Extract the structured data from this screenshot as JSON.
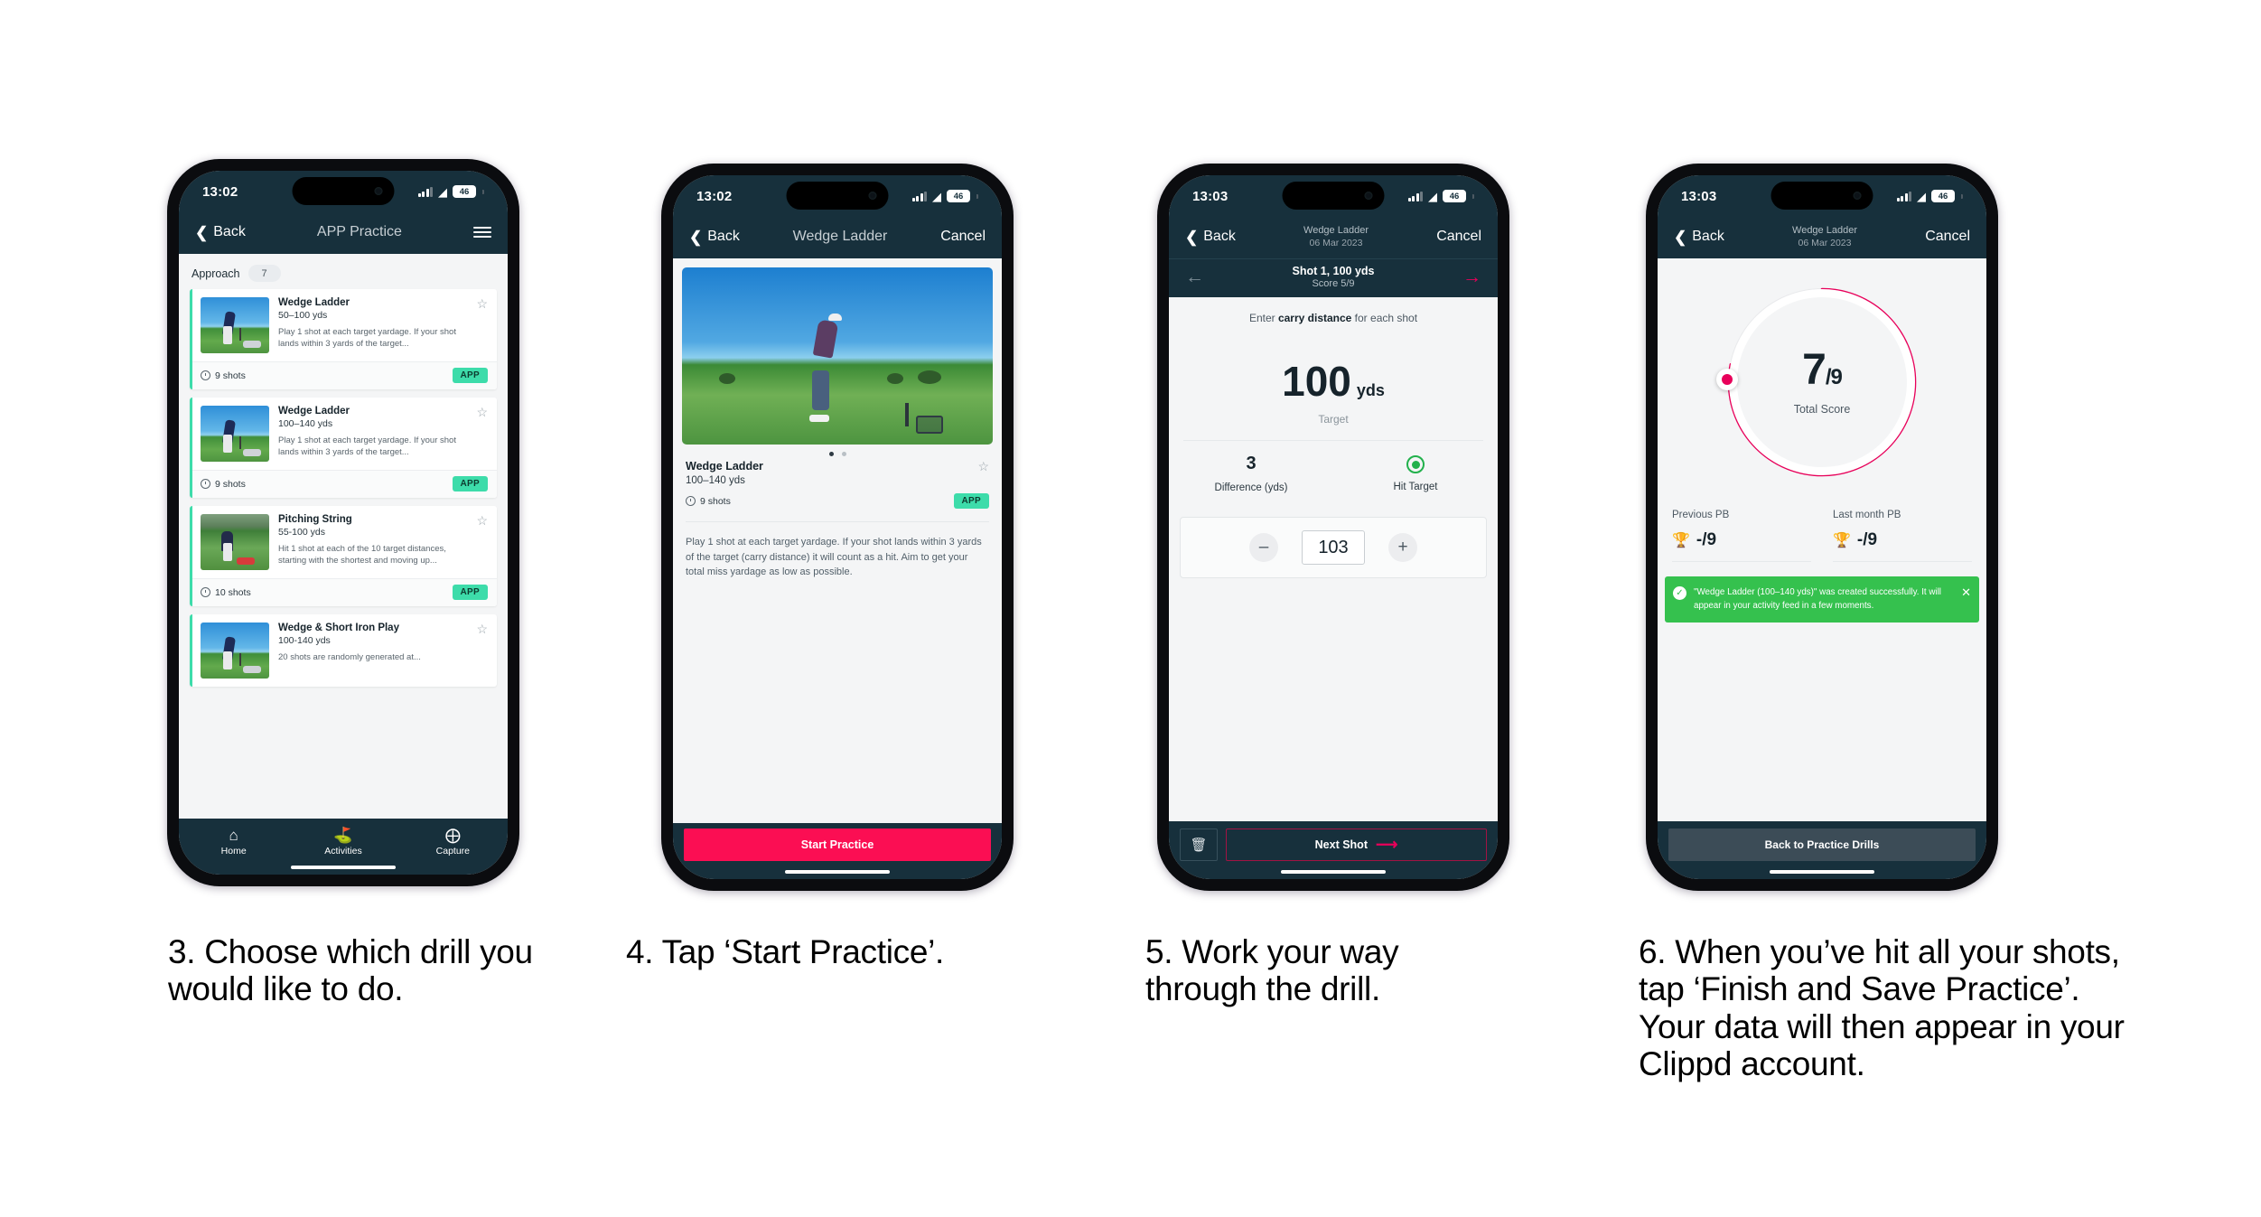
{
  "theme": {
    "navy": "#17303c",
    "pink": "#fb0e53",
    "teal": "#3ddcaa",
    "green": "#35c14e",
    "page_bg": "#ffffff"
  },
  "phones": [
    {
      "id": "phone-1",
      "status": {
        "time": "13:02",
        "battery": "46"
      },
      "nav": {
        "back": "Back",
        "title": "APP Practice",
        "menu_icon": "hamburger-icon"
      },
      "section": {
        "label": "Approach",
        "count": "7"
      },
      "cards": [
        {
          "title": "Wedge Ladder",
          "range": "50–100 yds",
          "desc": "Play 1 shot at each target yardage. If your shot lands within 3 yards of the target...",
          "shots": "9 shots",
          "tag": "APP"
        },
        {
          "title": "Wedge Ladder",
          "range": "100–140 yds",
          "desc": "Play 1 shot at each target yardage. If your shot lands within 3 yards of the target...",
          "shots": "9 shots",
          "tag": "APP"
        },
        {
          "title": "Pitching String",
          "range": "55-100 yds",
          "desc": "Hit 1 shot at each of the 10 target distances, starting with the shortest and moving up...",
          "shots": "10 shots",
          "tag": "APP"
        },
        {
          "title": "Wedge & Short Iron Play",
          "range": "100-140 yds",
          "desc": "20 shots are randomly generated at...",
          "shots": "",
          "tag": ""
        }
      ],
      "tabs": [
        {
          "label": "Home",
          "icon": "home-icon"
        },
        {
          "label": "Activities",
          "icon": "golf-flag-icon"
        },
        {
          "label": "Capture",
          "icon": "plus-circle-icon"
        }
      ]
    },
    {
      "id": "phone-2",
      "status": {
        "time": "13:02",
        "battery": "46"
      },
      "nav": {
        "back": "Back",
        "title": "Wedge Ladder",
        "cancel": "Cancel"
      },
      "detail": {
        "title": "Wedge Ladder",
        "range": "100–140 yds",
        "shots": "9 shots",
        "tag": "APP",
        "description": "Play 1 shot at each target yardage. If your shot lands within 3 yards of the target (carry distance) it will count as a hit. Aim to get your total miss yardage as low as possible."
      },
      "cta": "Start Practice"
    },
    {
      "id": "phone-3",
      "status": {
        "time": "13:03",
        "battery": "46"
      },
      "nav": {
        "back": "Back",
        "title": "Wedge Ladder",
        "subtitle": "06 Mar 2023",
        "cancel": "Cancel"
      },
      "shotbar": {
        "title": "Shot 1, 100 yds",
        "score": "Score 5/9"
      },
      "prompt_pre": "Enter ",
      "prompt_bold": "carry distance",
      "prompt_post": " for each shot",
      "target": {
        "value": "100",
        "unit": "yds",
        "label": "Target"
      },
      "metrics": [
        {
          "value": "3",
          "label": "Difference (yds)"
        },
        {
          "value": "",
          "label": "Hit Target"
        }
      ],
      "stepper": {
        "minus": "–",
        "value": "103",
        "plus": "+"
      },
      "footer": {
        "delete_icon": "trash-icon",
        "next": "Next Shot"
      }
    },
    {
      "id": "phone-4",
      "status": {
        "time": "13:03",
        "battery": "46"
      },
      "nav": {
        "back": "Back",
        "title": "Wedge Ladder",
        "subtitle": "06 Mar 2023",
        "cancel": "Cancel"
      },
      "gauge": {
        "score": "7",
        "outof": "/9",
        "label": "Total Score",
        "percent": 78
      },
      "pbs": [
        {
          "label": "Previous PB",
          "value": "-/9",
          "icon": "trophy-icon"
        },
        {
          "label": "Last month PB",
          "value": "-/9",
          "icon": "trophy-icon"
        }
      ],
      "toast": {
        "message": "\"Wedge Ladder (100–140 yds)\" was created successfully. It will appear in your activity feed in a few moments.",
        "check_icon": "check-circle-icon",
        "close_icon": "close-icon"
      },
      "cta": "Back to Practice Drills"
    }
  ],
  "captions": [
    {
      "text": "3. Choose which drill you would like to do."
    },
    {
      "text": "4. Tap ‘Start Practice’."
    },
    {
      "text": "5. Work your way through the drill."
    },
    {
      "text": "6. When you’ve hit all your shots, tap ‘Finish and Save Practice’. Your data will then appear in your Clippd account."
    }
  ]
}
